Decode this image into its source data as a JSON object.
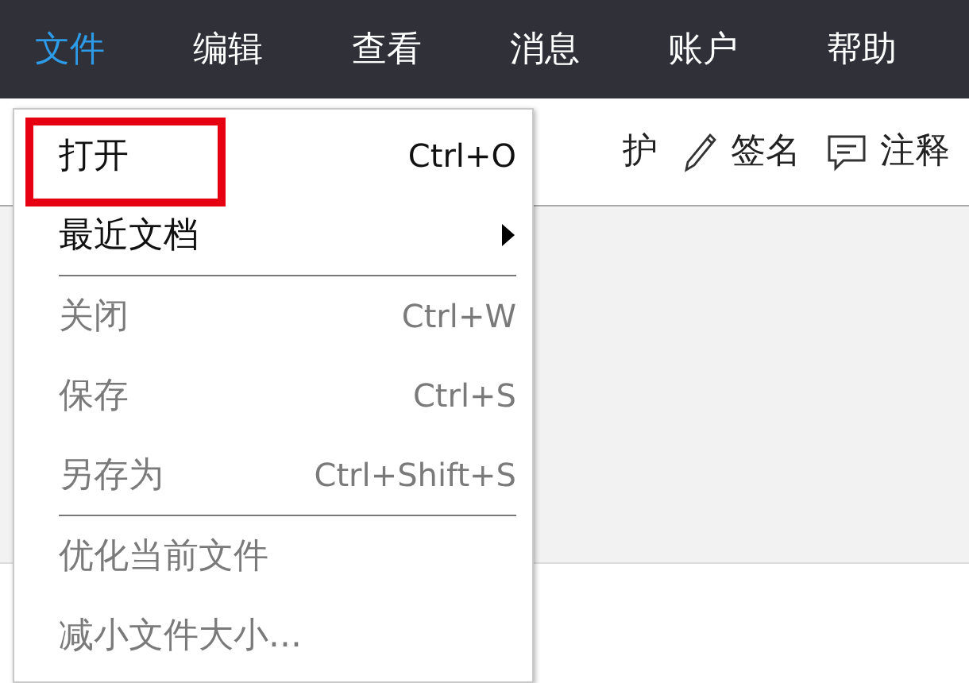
{
  "menubar": [
    {
      "label": "文件",
      "selected": true
    },
    {
      "label": "编辑",
      "selected": false
    },
    {
      "label": "查看",
      "selected": false
    },
    {
      "label": "消息",
      "selected": false
    },
    {
      "label": "账户",
      "selected": false
    },
    {
      "label": "帮助",
      "selected": false
    }
  ],
  "toolbar": [
    {
      "kind": "text",
      "label": "护"
    },
    {
      "kind": "pen",
      "label": "签名"
    },
    {
      "kind": "comment",
      "label": "注释"
    }
  ],
  "file_menu": [
    {
      "kind": "item",
      "label": "打开",
      "shortcut": "Ctrl+O",
      "disabled": false,
      "highlighted": true
    },
    {
      "kind": "submenu",
      "label": "最近文档",
      "disabled": false,
      "highlighted": false
    },
    {
      "kind": "separator"
    },
    {
      "kind": "item",
      "label": "关闭",
      "shortcut": "Ctrl+W",
      "disabled": true,
      "highlighted": false
    },
    {
      "kind": "item",
      "label": "保存",
      "shortcut": "Ctrl+S",
      "disabled": true,
      "highlighted": false
    },
    {
      "kind": "item",
      "label": "另存为",
      "shortcut": "Ctrl+Shift+S",
      "disabled": true,
      "highlighted": false
    },
    {
      "kind": "separator"
    },
    {
      "kind": "item",
      "label": "优化当前文件",
      "disabled": true,
      "highlighted": false
    },
    {
      "kind": "item",
      "label": "减小文件大小...",
      "disabled": true,
      "highlighted": false
    }
  ]
}
